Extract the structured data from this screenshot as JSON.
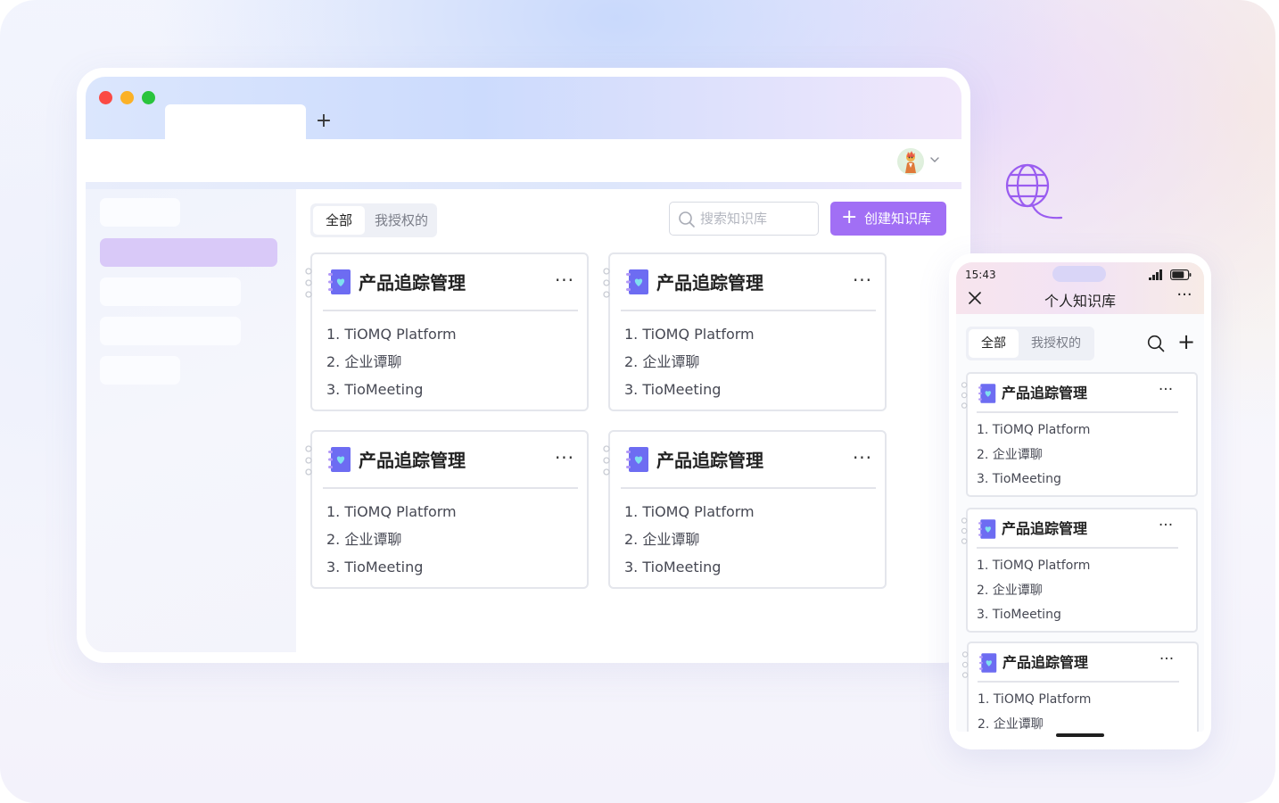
{
  "colors": {
    "accent": "#a16ff5",
    "sidebar_active": "#d9c9f8",
    "close_dot": "#fb4a44",
    "minimize_dot": "#fbb127",
    "maximize_dot": "#29c43d"
  },
  "browser": {
    "new_tab_symbol": "+"
  },
  "desktop": {
    "filters": {
      "all": "全部",
      "authorized": "我授权的"
    },
    "search": {
      "placeholder": "搜索知识库"
    },
    "create_button": {
      "icon": "+",
      "label": "创建知识库"
    },
    "cards": [
      {
        "title": "产品追踪管理",
        "more": "···",
        "items": [
          "1. TiOMQ Platform",
          "2. 企业谭聊",
          "3. TioMeeting"
        ]
      },
      {
        "title": "产品追踪管理",
        "more": "···",
        "items": [
          "1. TiOMQ Platform",
          "2. 企业谭聊",
          "3. TioMeeting"
        ]
      },
      {
        "title": "产品追踪管理",
        "more": "···",
        "items": [
          "1. TiOMQ Platform",
          "2. 企业谭聊",
          "3. TioMeeting"
        ]
      },
      {
        "title": "产品追踪管理",
        "more": "···",
        "items": [
          "1. TiOMQ Platform",
          "2. 企业谭聊",
          "3. TioMeeting"
        ]
      }
    ]
  },
  "mobile": {
    "status_time": "15:43",
    "title": "个人知识库",
    "more": "···",
    "add_symbol": "+",
    "filters": {
      "all": "全部",
      "authorized": "我授权的"
    },
    "cards": [
      {
        "title": "产品追踪管理",
        "more": "···",
        "items": [
          "1. TiOMQ Platform",
          "2. 企业谭聊",
          "3. TioMeeting"
        ]
      },
      {
        "title": "产品追踪管理",
        "more": "···",
        "items": [
          "1. TiOMQ Platform",
          "2. 企业谭聊",
          "3. TioMeeting"
        ]
      },
      {
        "title": "产品追踪管理",
        "more": "···",
        "items": [
          "1. TiOMQ Platform",
          "2. 企业谭聊"
        ]
      }
    ]
  }
}
